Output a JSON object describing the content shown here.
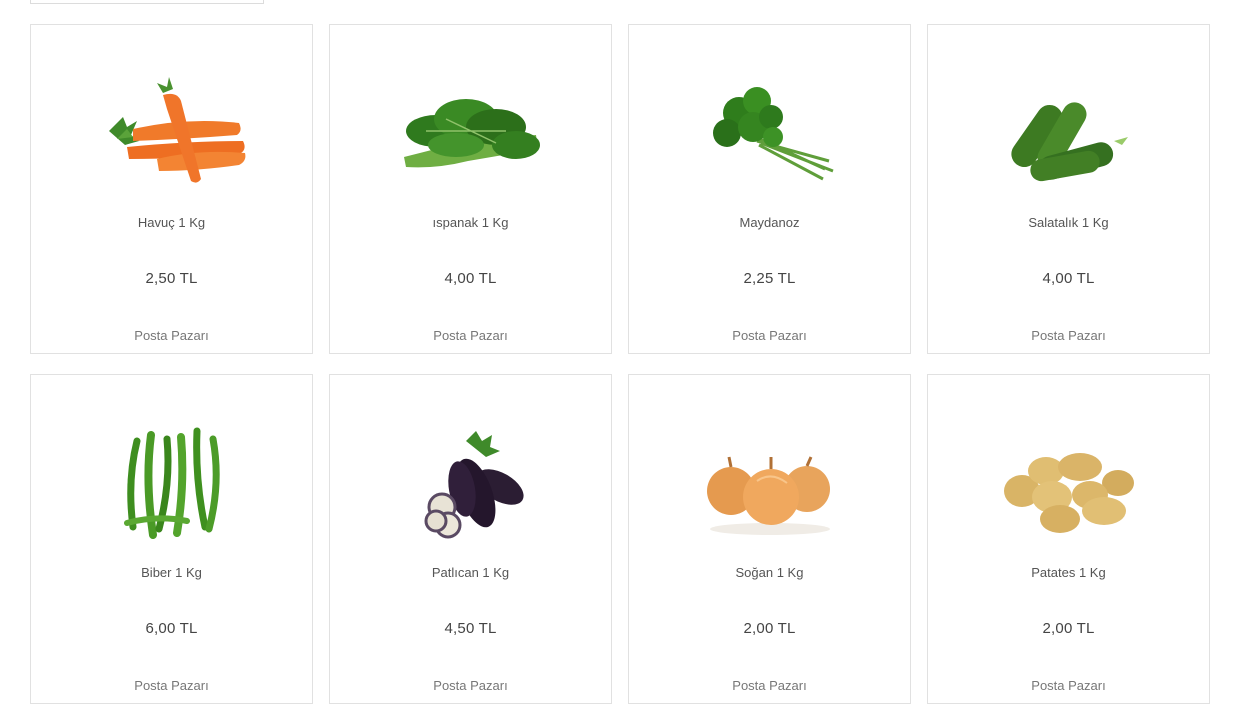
{
  "products": [
    {
      "name": "Havuç 1 Kg",
      "price": "2,50 TL",
      "seller": "Posta Pazarı",
      "icon": "carrot-icon"
    },
    {
      "name": "ıspanak 1 Kg",
      "price": "4,00 TL",
      "seller": "Posta Pazarı",
      "icon": "spinach-icon"
    },
    {
      "name": "Maydanoz",
      "price": "2,25 TL",
      "seller": "Posta Pazarı",
      "icon": "parsley-icon"
    },
    {
      "name": "Salatalık 1 Kg",
      "price": "4,00 TL",
      "seller": "Posta Pazarı",
      "icon": "cucumber-icon"
    },
    {
      "name": "Biber 1 Kg",
      "price": "6,00 TL",
      "seller": "Posta Pazarı",
      "icon": "pepper-icon"
    },
    {
      "name": "Patlıcan 1 Kg",
      "price": "4,50 TL",
      "seller": "Posta Pazarı",
      "icon": "eggplant-icon"
    },
    {
      "name": "Soğan 1 Kg",
      "price": "2,00 TL",
      "seller": "Posta Pazarı",
      "icon": "onion-icon"
    },
    {
      "name": "Patates 1 Kg",
      "price": "2,00 TL",
      "seller": "Posta Pazarı",
      "icon": "potato-icon"
    }
  ]
}
